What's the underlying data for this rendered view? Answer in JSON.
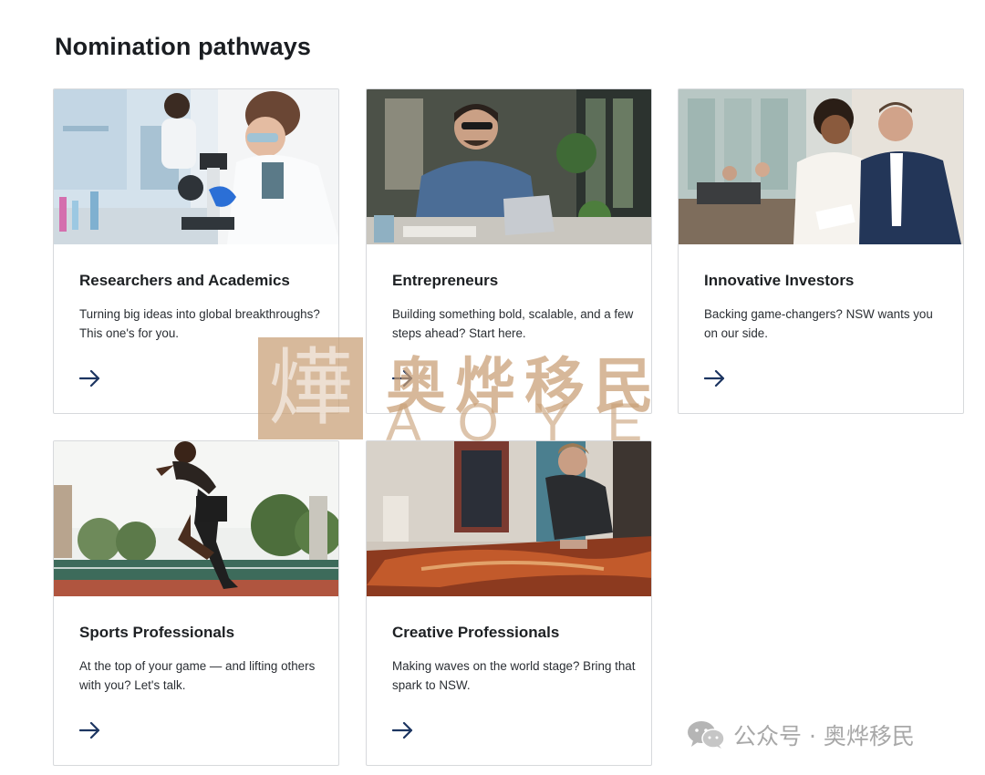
{
  "page": {
    "title": "Nomination pathways"
  },
  "cards": [
    {
      "title": "Researchers and Academics",
      "description": "Turning big ideas into global breakthroughs? This one's for you.",
      "arrow_icon": "arrow-right-icon"
    },
    {
      "title": "Entrepreneurs",
      "description": "Building something bold, scalable, and a few steps ahead? Start here.",
      "arrow_icon": "arrow-right-icon"
    },
    {
      "title": "Innovative Investors",
      "description": "Backing game-changers? NSW wants you on our side.",
      "arrow_icon": "arrow-right-icon"
    },
    {
      "title": "Sports Professionals",
      "description": "At the top of your game — and lifting others with you? Let's talk.",
      "arrow_icon": "arrow-right-icon"
    },
    {
      "title": "Creative Professionals",
      "description": "Making waves on the world stage? Bring that spark to NSW.",
      "arrow_icon": "arrow-right-icon"
    }
  ],
  "watermark": {
    "seal_char": "燁",
    "chinese": "奥烨移民",
    "latin": "AOYE"
  },
  "wechat_tag": {
    "text": "公众号 · 奥烨移民",
    "icon": "wechat-icon"
  },
  "colors": {
    "arrow": "#1c3561",
    "card_border": "#d7d9dc",
    "watermark": "#c89e74"
  }
}
